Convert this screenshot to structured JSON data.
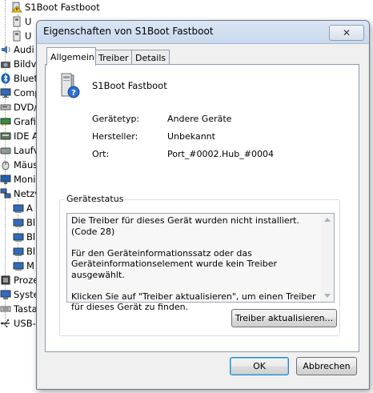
{
  "tree": {
    "items": [
      {
        "label": "S1Boot Fastboot",
        "icon": "warning-device-icon"
      },
      {
        "label": "U",
        "icon": "usb-device-icon"
      },
      {
        "label": "U",
        "icon": "usb-device-icon"
      },
      {
        "label": "Audi",
        "icon": "audio-icon"
      },
      {
        "label": "Bildv",
        "icon": "imaging-icon"
      },
      {
        "label": "Bluet",
        "icon": "bluetooth-icon"
      },
      {
        "label": "Comp",
        "icon": "computer-icon"
      },
      {
        "label": "DVD/",
        "icon": "dvd-icon"
      },
      {
        "label": "Grafik",
        "icon": "display-adapter-icon"
      },
      {
        "label": "IDE A",
        "icon": "ide-icon"
      },
      {
        "label": "Laufv",
        "icon": "drive-icon"
      },
      {
        "label": "Mäus",
        "icon": "mouse-icon"
      },
      {
        "label": "Moni",
        "icon": "monitor-icon"
      },
      {
        "label": "Netzv",
        "icon": "network-icon"
      },
      {
        "label": "A",
        "icon": "network-adapter-icon"
      },
      {
        "label": "Bl",
        "icon": "network-adapter-icon"
      },
      {
        "label": "Bl",
        "icon": "network-adapter-icon"
      },
      {
        "label": "Bl",
        "icon": "network-adapter-icon"
      },
      {
        "label": "M",
        "icon": "network-adapter-icon"
      },
      {
        "label": "Proze",
        "icon": "processor-icon"
      },
      {
        "label": "Syste",
        "icon": "system-icon"
      },
      {
        "label": "Tasta",
        "icon": "keyboard-icon"
      },
      {
        "label": "USB-",
        "icon": "usb-controller-icon"
      }
    ]
  },
  "dialog": {
    "title": "Eigenschaften von S1Boot Fastboot",
    "close_glyph": "✕",
    "tabs": [
      {
        "label": "Allgemein",
        "active": true
      },
      {
        "label": "Treiber",
        "active": false
      },
      {
        "label": "Details",
        "active": false
      }
    ],
    "device_name": "S1Boot Fastboot",
    "device_icon": "unknown-device-icon",
    "properties": [
      {
        "label": "Gerätetyp:",
        "value": "Andere Geräte"
      },
      {
        "label": "Hersteller:",
        "value": "Unbekannt"
      },
      {
        "label": "Ort:",
        "value": "Port_#0002.Hub_#0004"
      }
    ],
    "status_group_title": "Gerätestatus",
    "status_lines": [
      "Die Treiber für dieses Gerät wurden nicht installiert. (Code 28)",
      "Für den Geräteinformationssatz oder das Geräteinformationselement wurde kein Treiber ausgewählt.",
      "Klicken Sie auf \"Treiber aktualisieren\", um einen Treiber für dieses Gerät zu finden."
    ],
    "update_driver_label": "Treiber aktualisieren...",
    "ok_label": "OK",
    "cancel_label": "Abbrechen"
  },
  "colors": {
    "title_bar": "#c9d9ee",
    "default_button_border": "#3c7fb1",
    "warning": "#e8b000"
  }
}
